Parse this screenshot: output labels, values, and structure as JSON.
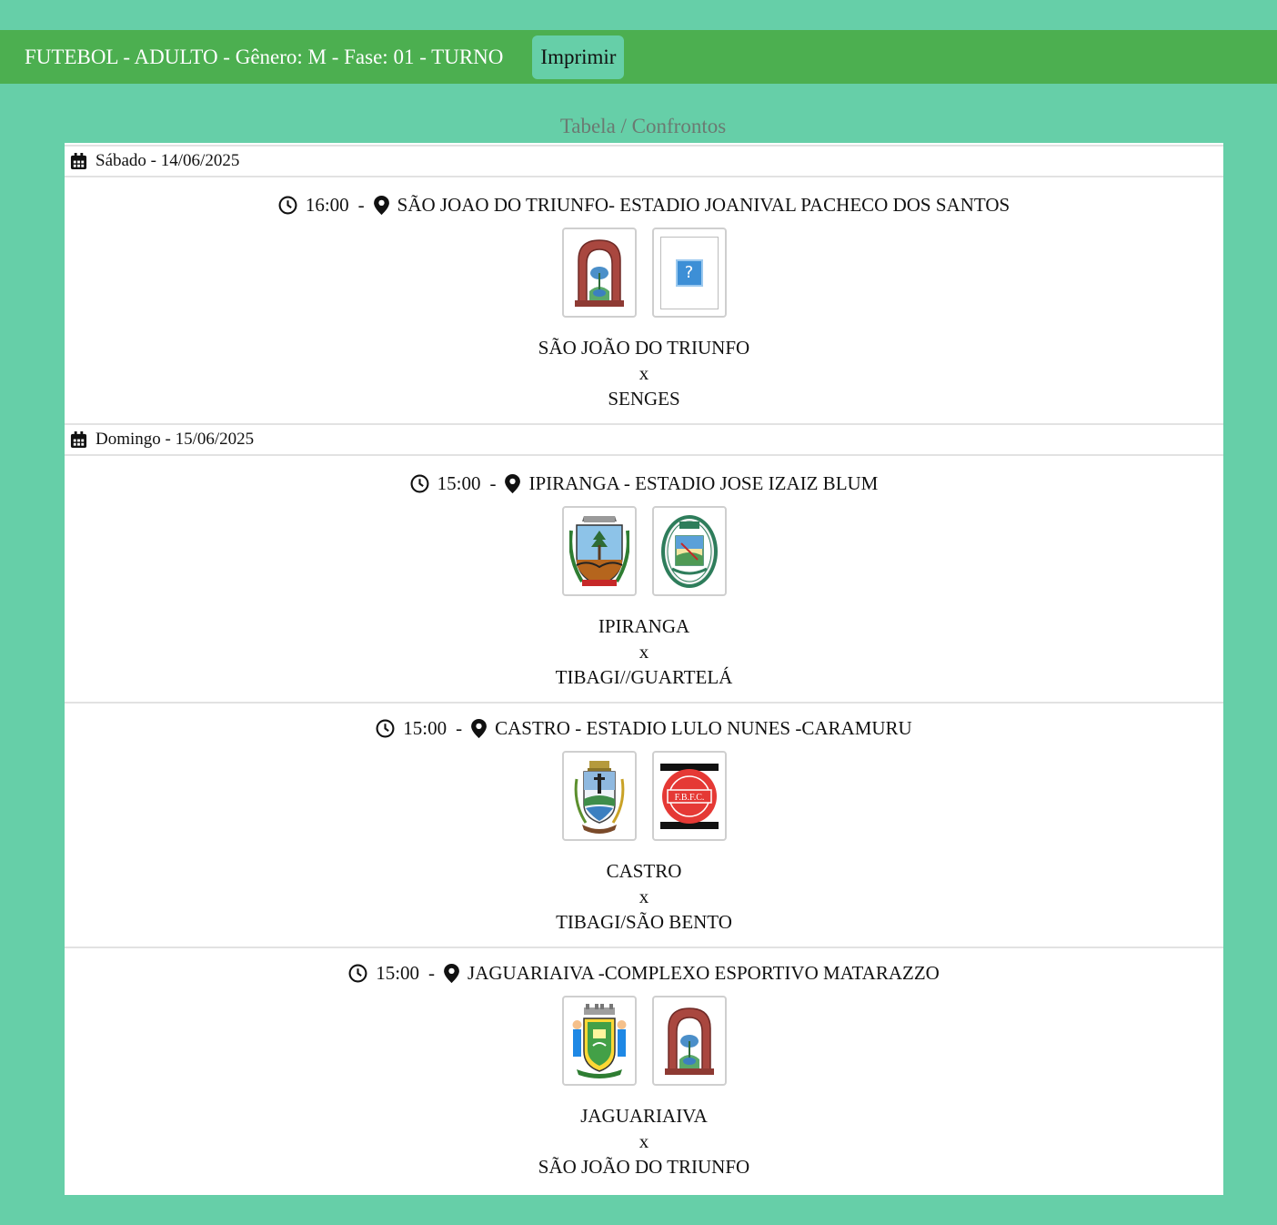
{
  "header": {
    "title": "FUTEBOL - ADULTO - Gênero: M - Fase: 01 - TURNO",
    "print_label": "Imprimir"
  },
  "section_title": "Tabela / Confrontos",
  "days": [
    {
      "label": "Sábado - 14/06/2025",
      "matches": [
        {
          "time": "16:00",
          "venue": "SÃO JOAO DO TRIUNFO- ESTADIO JOANIVAL PACHECO DOS SANTOS",
          "home": "SÃO JOÃO DO TRIUNFO",
          "vs": "x",
          "away": "SENGES",
          "home_logo": "sao-joao-do-triunfo-crest",
          "away_logo": "missing-image"
        }
      ]
    },
    {
      "label": "Domingo - 15/06/2025",
      "matches": [
        {
          "time": "15:00",
          "venue": "IPIRANGA - ESTADIO JOSE IZAIZ BLUM",
          "home": "IPIRANGA",
          "vs": "x",
          "away": "TIBAGI//GUARTELÁ",
          "home_logo": "ipiranga-crest",
          "away_logo": "tibagi-guartela-crest"
        },
        {
          "time": "15:00",
          "venue": "CASTRO - ESTADIO LULO NUNES -CARAMURU",
          "home": "CASTRO",
          "vs": "x",
          "away": "TIBAGI/SÃO BENTO",
          "home_logo": "castro-crest",
          "away_logo": "sao-bento-fbc-crest"
        },
        {
          "time": "15:00",
          "venue": "JAGUARIAIVA -COMPLEXO ESPORTIVO MATARAZZO",
          "home": "JAGUARIAIVA",
          "vs": "x",
          "away": "SÃO JOÃO DO TRIUNFO",
          "home_logo": "jaguariaiva-crest",
          "away_logo": "sao-joao-do-triunfo-crest"
        }
      ]
    }
  ],
  "logo_text": {
    "missing": "?",
    "fbc": "F.B.F.C."
  },
  "colors": {
    "background": "#66cfa8",
    "header_bar": "#4caf50",
    "panel": "#ffffff"
  }
}
